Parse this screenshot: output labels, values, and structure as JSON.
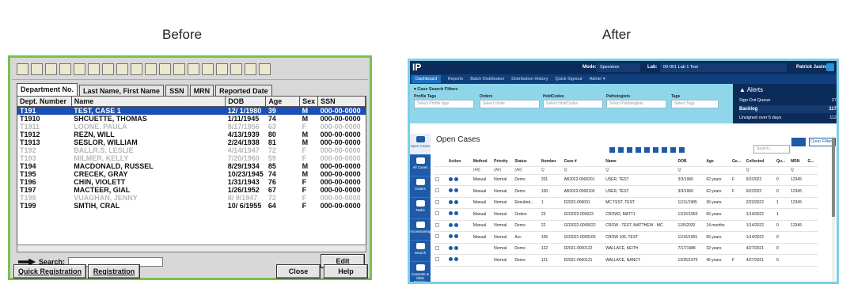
{
  "headings": {
    "before": "Before",
    "after": "After"
  },
  "old": {
    "toolbar_icons": [
      "scan-icon",
      "print-icon",
      "cut-icon",
      "paste-icon",
      "search-icon",
      "chart-icon",
      "tag-icon",
      "globe-icon",
      "off-icon",
      "calendar-icon",
      "doc-icon",
      "list-icon",
      "grid-icon",
      "book-icon",
      "preview-icon",
      "printer-icon",
      "pin-icon",
      "person-icon"
    ],
    "tabs": [
      "Department No.",
      "Last Name, First Name",
      "SSN",
      "MRN",
      "Reported Date"
    ],
    "columns": [
      "Dept. Number",
      "Name",
      "DOB",
      "Age",
      "Sex",
      "SSN"
    ],
    "rows": [
      [
        "T191",
        "TEST, CASE 1",
        "12/ 1/1980",
        "39",
        "M",
        "000-00-0000",
        "sel"
      ],
      [
        "T1910",
        "SHCUETTE, THOMAS",
        "1/11/1945",
        "74",
        "M",
        "000-00-0000",
        ""
      ],
      [
        "T1911",
        "LOONE, PAULA",
        "8/17/1956",
        "63",
        "F",
        "000-00-0000",
        "dim"
      ],
      [
        "T1912",
        "REZN, WILL",
        "4/13/1939",
        "80",
        "M",
        "000-00-0000",
        ""
      ],
      [
        "T1913",
        "SESLOR, WILLIAM",
        "2/24/1938",
        "81",
        "M",
        "000-00-0000",
        ""
      ],
      [
        "T192",
        "BALLR.S, LESLIE",
        "4/14/1947",
        "72",
        "F",
        "000-00-0000",
        "dim"
      ],
      [
        "T193",
        "MILMER, KELLY",
        "7/20/1960",
        "59",
        "F",
        "000-00-0000",
        "dim"
      ],
      [
        "T194",
        "MACDONALD, RUSSEL",
        "8/29/1934",
        "85",
        "M",
        "000-00-0000",
        ""
      ],
      [
        "T195",
        "CRECEK, GRAY",
        "10/23/1945",
        "74",
        "M",
        "000-00-0000",
        ""
      ],
      [
        "T196",
        "CHIN, VIOLETT",
        "1/31/1943",
        "76",
        "F",
        "000-00-0000",
        ""
      ],
      [
        "T197",
        "MACTEER, GIAL",
        "1/26/1952",
        "67",
        "F",
        "000-00-0000",
        ""
      ],
      [
        "T198",
        "VUAGHAN, JENNY",
        "8/ 9/1947",
        "72",
        "F",
        "000-00-0000",
        "dim"
      ],
      [
        "T199",
        "SMTIH, CRAL",
        "10/ 6/1955",
        "64",
        "F",
        "000-00-0000",
        ""
      ]
    ],
    "search_label": "Search:",
    "buttons": {
      "edit": "Edit",
      "quick_registration": "Quick Registration",
      "registration": "Registration",
      "close": "Close",
      "help": "Help"
    }
  },
  "new": {
    "logo": "IP",
    "mode_label": "Mode:",
    "mode_value": "Specimen",
    "lab_label": "Lab:",
    "lab_value": "00-001 Lab 1 Test",
    "user": "Patrick Jasinski",
    "nav": [
      "Dashboard",
      "Reports",
      "Batch Distribution",
      "Distribution History",
      "Quick Signout",
      "Admin ▾"
    ],
    "filters": {
      "title": "▾  Case Search Filters",
      "fields": [
        {
          "label": "Profile Tags",
          "ph": "Select Profile tags"
        },
        {
          "label": "Orders",
          "ph": "Select Order"
        },
        {
          "label": "HoldCodes",
          "ph": "Select HoldCodes"
        },
        {
          "label": "Pathologists",
          "ph": "Select Pathologists"
        },
        {
          "label": "Tags",
          "ph": "Select Tags"
        }
      ]
    },
    "alerts": {
      "title": "Alerts",
      "rows": [
        {
          "label": "Sign Out Queue",
          "count": "27"
        },
        {
          "label": "Backlog",
          "count": "117"
        },
        {
          "label": "Unsigned over 5 days",
          "count": "112"
        }
      ]
    },
    "side": [
      "Open Cases",
      "All Cases",
      "Orders",
      "Tasks",
      "Accessioning",
      "Search",
      "Cassette & Slide Printing"
    ],
    "title": "Open Cases",
    "search_ph": "Search...",
    "clear_filters": "Clear Filters",
    "columns": [
      "",
      "Action",
      "Method",
      "Priority",
      "Status",
      "Number",
      "Case #",
      "Name",
      "DOB",
      "Age",
      "Ge...",
      "Collected",
      "Qu...",
      "MRN",
      "G..."
    ],
    "filter_row": [
      "",
      "",
      "(All)",
      "(All)",
      "(All)",
      "Q",
      "Q",
      "Q",
      "Q",
      "",
      "",
      "Q",
      "",
      "Q",
      ""
    ],
    "rows": [
      [
        "Manual",
        "Normal",
        "Demo",
        "201",
        "AB2022-0000201",
        "USER, TEST",
        "3/3/1960",
        "62 years",
        "F",
        "9/2/2022",
        "0",
        "12345"
      ],
      [
        "Manual",
        "Normal",
        "Demo",
        "100",
        "AB2022-0000100",
        "USER, TEST",
        "3/3/1960",
        "62 years",
        "F",
        "9/2/2022",
        "0",
        "12345"
      ],
      [
        "Manual",
        "Normal",
        "Resulted...",
        "1",
        "D2022-000001",
        "MC TEST, TEST",
        "11/11/1985",
        "36 years",
        "",
        "2/23/2022",
        "1",
        "12345"
      ],
      [
        "Manual",
        "Normal",
        "Orders",
        "23",
        "GO2022-000023",
        "CROW2, MATT1",
        "12/15/1955",
        "66 years",
        "",
        "1/14/2022",
        "1",
        ""
      ],
      [
        "Manual",
        "Normal",
        "Demo",
        "22",
        "GO2022-0000022",
        "CROW - TEST, MATTHEW - MC",
        "11/5/2020",
        "14 months",
        "",
        "1/14/2022",
        "0",
        "12345"
      ],
      [
        "Manual",
        "Normal",
        "Acc",
        "105",
        "GO2021-0000105",
        "CROW 105, TEST",
        "11/16/1955",
        "65 years",
        "",
        "1/14/2022",
        "0",
        ""
      ],
      [
        "",
        "Normal",
        "Demo",
        "122",
        "D2021-0000122",
        "WALLACE, KEITH",
        "7/17/1988",
        "32 years",
        "",
        "4/27/2021",
        "0",
        ""
      ],
      [
        "",
        "Normal",
        "Demo",
        "121",
        "D2021-0000121",
        "WALLACE, NANCY",
        "12/25/1975",
        "45 years",
        "F",
        "4/27/2021",
        "0",
        ""
      ]
    ]
  }
}
